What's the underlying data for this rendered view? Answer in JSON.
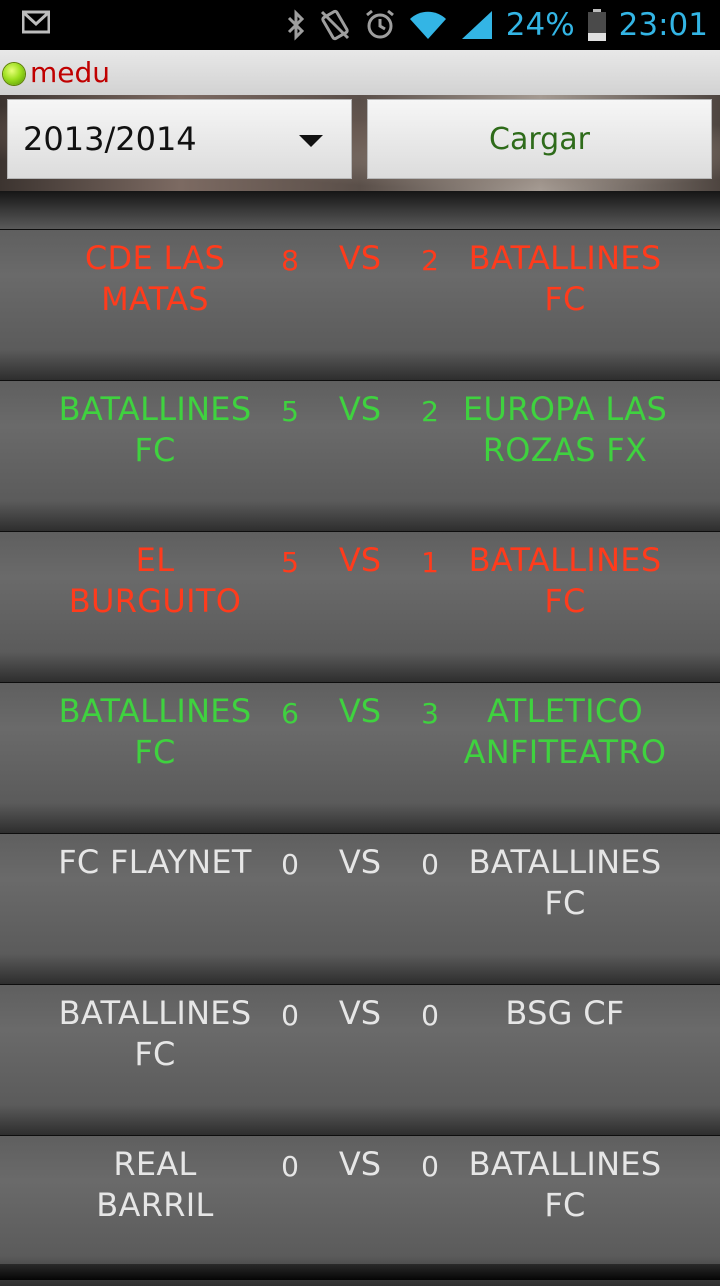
{
  "status_bar": {
    "battery_percent": "24%",
    "time": "23:01",
    "icons": [
      "gmail-icon",
      "bluetooth-icon",
      "vibrate-icon",
      "alarm-icon",
      "wifi-icon",
      "signal-icon",
      "battery-icon"
    ]
  },
  "app": {
    "title": "medu",
    "title_color": "#c00000"
  },
  "controls": {
    "season_selected": "2013/2014",
    "load_label": "Cargar"
  },
  "colors": {
    "loss": "#ff3b1c",
    "win": "#3fd23f",
    "draw": "#e6e6e6"
  },
  "matches": [
    {
      "home": "CDE LAS MATAS",
      "home_score": "8",
      "vs": "VS",
      "away_score": "2",
      "away": "BATALLINES FC",
      "result": "loss"
    },
    {
      "home": "BATALLINES FC",
      "home_score": "5",
      "vs": "VS",
      "away_score": "2",
      "away": "EUROPA LAS ROZAS FX",
      "result": "win"
    },
    {
      "home": "EL BURGUITO",
      "home_score": "5",
      "vs": "VS",
      "away_score": "1",
      "away": "BATALLINES FC",
      "result": "loss"
    },
    {
      "home": "BATALLINES FC",
      "home_score": "6",
      "vs": "VS",
      "away_score": "3",
      "away": "ATLETICO ANFITEATRO",
      "result": "win"
    },
    {
      "home": "FC FLAYNET",
      "home_score": "0",
      "vs": "VS",
      "away_score": "0",
      "away": "BATALLINES FC",
      "result": "draw"
    },
    {
      "home": "BATALLINES FC",
      "home_score": "0",
      "vs": "VS",
      "away_score": "0",
      "away": "BSG CF",
      "result": "draw"
    },
    {
      "home": "REAL BARRIL",
      "home_score": "0",
      "vs": "VS",
      "away_score": "0",
      "away": "BATALLINES FC",
      "result": "draw"
    }
  ]
}
